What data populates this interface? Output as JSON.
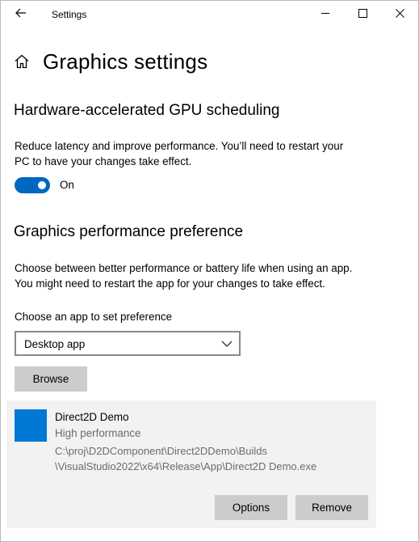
{
  "window": {
    "title": "Settings",
    "icons": {
      "back": "back-arrow-icon",
      "minimize": "minimize-icon",
      "maximize": "maximize-icon",
      "close": "close-icon",
      "home": "home-icon",
      "chevron": "chevron-down-icon"
    }
  },
  "page": {
    "title": "Graphics settings"
  },
  "gpu_scheduling": {
    "title": "Hardware-accelerated GPU scheduling",
    "description_line1": "Reduce latency and improve performance. You’ll need to restart your",
    "description_line2": "PC to have your changes take effect.",
    "toggle_state": "On",
    "toggle_on": true
  },
  "performance_pref": {
    "title": "Graphics performance preference",
    "description_line1": "Choose between better performance or battery life when using an app.",
    "description_line2": "You might need to restart the app for your changes to take effect.",
    "choose_label": "Choose an app to set preference",
    "dropdown_value": "Desktop app",
    "browse_label": "Browse"
  },
  "app_entry": {
    "name": "Direct2D Demo",
    "preference": "High performance",
    "path_line1": "C:\\proj\\D2DComponent\\Direct2DDemo\\Builds",
    "path_line2": "\\VisualStudio2022\\x64\\Release\\App\\Direct2D Demo.exe",
    "options_label": "Options",
    "remove_label": "Remove"
  },
  "colors": {
    "accent": "#0067c0",
    "app_icon": "#0078d4",
    "button_bg": "#cccccc",
    "card_bg": "#f2f2f2",
    "secondary_text": "#6b6b6b"
  }
}
